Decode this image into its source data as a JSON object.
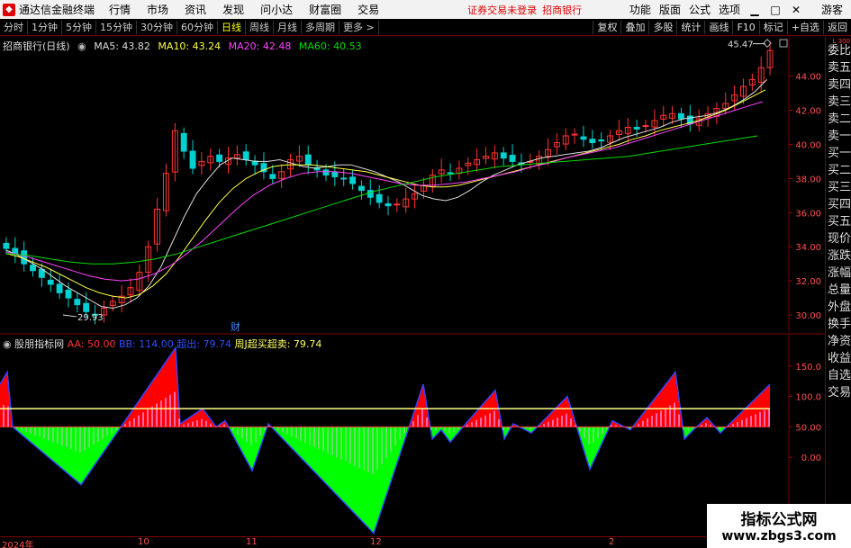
{
  "titlebar": {
    "app_title": "通达信金融终端",
    "menu": [
      "行情",
      "市场",
      "资讯",
      "发现",
      "问小达",
      "财富圈",
      "交易"
    ],
    "notice": "证券交易未登录",
    "notice2": "招商银行",
    "right_items": [
      "功能",
      "版面",
      "公式",
      "选项"
    ],
    "guest": "游客"
  },
  "toolbar": {
    "periods": [
      "分时",
      "1分钟",
      "5分钟",
      "15分钟",
      "30分钟",
      "60分钟",
      "日线",
      "周线",
      "月线",
      "多周期",
      "更多 >"
    ],
    "active_index": 6,
    "right_buttons": [
      "复权",
      "叠加",
      "多股",
      "统计",
      "画线",
      "F10",
      "标记",
      "+自选",
      "返回"
    ]
  },
  "chart_info": {
    "stock": "招商银行(日线)",
    "ma5": "MA5: 43.82",
    "ma10": "MA10: 43.24",
    "ma20": "MA20: 42.48",
    "ma60": "MA60: 40.53",
    "high_label": "45.47",
    "low_label": "29.93",
    "marker": "财"
  },
  "indicator_info": {
    "name": "股朋指标网",
    "aa": "AA: 50.00",
    "bb": "BB: 114.00",
    "cc": "超出: 79.74",
    "dd": "周J超买超卖: 79.74"
  },
  "sidebar": {
    "items": [
      "委比",
      "卖五",
      "卖四",
      "卖三",
      "卖二",
      "卖一",
      "买一",
      "买二",
      "买三",
      "买四",
      "买五",
      "现价",
      "涨跌",
      "涨幅",
      "总量",
      "外盘",
      "换手",
      "净资",
      "收益",
      "自选",
      "交易"
    ],
    "mark": "L 300"
  },
  "date_axis": [
    "2024年",
    "10",
    "11",
    "12",
    "2"
  ],
  "watermark": {
    "main": "指标公式网",
    "sub": "www.zbgs3.com"
  },
  "colors": {
    "up": "#ff3333",
    "down": "#00d0d0",
    "green_fill": "#00ff00",
    "red_fill": "#ff0000",
    "ma5": "#dddddd",
    "ma10": "#ffff44",
    "ma20": "#ff44ff",
    "ma60": "#00dd00"
  },
  "chart_data": [
    {
      "type": "candlestick",
      "title": "招商银行(日线)",
      "y_axis_ticks": [
        30.0,
        32.0,
        34.0,
        36.0,
        38.0,
        40.0,
        42.0,
        44.0
      ],
      "ylim": [
        29.0,
        46.3
      ],
      "x_labels": [
        "2024年",
        "10",
        "11",
        "12",
        "2"
      ],
      "series_close": [
        33.9,
        33.6,
        33.0,
        32.6,
        32.2,
        31.8,
        31.3,
        31.0,
        30.6,
        30.2,
        30.0,
        30.4,
        30.8,
        31.1,
        31.6,
        32.5,
        34.0,
        36.2,
        38.3,
        40.8,
        39.6,
        38.6,
        39.0,
        39.3,
        39.0,
        39.2,
        39.4,
        39.1,
        38.8,
        38.4,
        38.0,
        38.4,
        39.1,
        39.3,
        38.8,
        38.5,
        38.2,
        38.1,
        38.0,
        37.7,
        37.3,
        36.9,
        36.6,
        36.4,
        36.5,
        36.8,
        37.1,
        37.6,
        38.2,
        38.5,
        38.3,
        38.6,
        38.9,
        39.1,
        39.3,
        39.5,
        39.2,
        39.0,
        38.9,
        39.0,
        39.3,
        39.7,
        40.1,
        40.5,
        40.6,
        40.3,
        40.1,
        40.2,
        40.5,
        40.8,
        41.0,
        40.9,
        41.1,
        41.4,
        41.7,
        41.8,
        41.5,
        41.2,
        41.5,
        41.8,
        42.1,
        42.4,
        42.9,
        43.4,
        43.8,
        44.5,
        45.5
      ],
      "series": [
        {
          "name": "MA5",
          "values": [
            33.8,
            33.5,
            33.1,
            32.7,
            32.2,
            31.7,
            31.3,
            30.9,
            30.5,
            30.4,
            30.6,
            31.0,
            31.7,
            32.8,
            34.3,
            35.8,
            37.1,
            38.0,
            38.8,
            39.2,
            39.1,
            39.0,
            39.0,
            39.1,
            38.9,
            38.7,
            38.6,
            38.7,
            38.8,
            38.8,
            38.6,
            38.4,
            38.1,
            37.8,
            37.4,
            37.0,
            36.8,
            36.7,
            36.9,
            37.3,
            37.8,
            38.2,
            38.5,
            38.8,
            39.0,
            39.2,
            39.3,
            39.4,
            39.5,
            39.6,
            39.8,
            40.1,
            40.4,
            40.6,
            40.8,
            41.0,
            41.3,
            41.5,
            41.6,
            41.7,
            41.9,
            42.2,
            42.6,
            43.1,
            43.8
          ]
        },
        {
          "name": "MA10",
          "values": [
            33.6,
            33.4,
            33.1,
            32.8,
            32.4,
            32.0,
            31.6,
            31.3,
            31.1,
            31.0,
            31.2,
            31.7,
            32.4,
            33.4,
            34.5,
            35.6,
            36.6,
            37.4,
            38.0,
            38.4,
            38.7,
            38.8,
            38.8,
            38.8,
            38.7,
            38.6,
            38.5,
            38.4,
            38.2,
            38.0,
            37.8,
            37.6,
            37.5,
            37.5,
            37.6,
            37.8,
            38.0,
            38.2,
            38.4,
            38.6,
            38.8,
            39.0,
            39.2,
            39.4,
            39.6,
            39.8,
            40.0,
            40.3,
            40.5,
            40.8,
            41.0,
            41.2,
            41.4,
            41.7,
            42.0,
            42.4,
            42.8,
            43.2
          ]
        },
        {
          "name": "MA20",
          "values": [
            33.7,
            33.5,
            33.2,
            32.9,
            32.6,
            32.3,
            32.1,
            32.0,
            32.1,
            32.4,
            32.9,
            33.6,
            34.4,
            35.3,
            36.2,
            37.0,
            37.6,
            38.0,
            38.3,
            38.4,
            38.4,
            38.3,
            38.1,
            37.9,
            37.7,
            37.6,
            37.6,
            37.7,
            37.8,
            38.0,
            38.2,
            38.4,
            38.7,
            38.9,
            39.2,
            39.4,
            39.6,
            39.8,
            40.1,
            40.4,
            40.7,
            41.0,
            41.3,
            41.6,
            41.9,
            42.2,
            42.5
          ]
        },
        {
          "name": "MA60",
          "values": [
            33.6,
            33.5,
            33.3,
            33.1,
            33.0,
            33.0,
            33.1,
            33.3,
            33.6,
            34.0,
            34.4,
            34.8,
            35.2,
            35.6,
            36.0,
            36.4,
            36.8,
            37.2,
            37.5,
            37.8,
            38.1,
            38.3,
            38.5,
            38.7,
            38.8,
            38.9,
            39.0,
            39.1,
            39.2,
            39.3,
            39.5,
            39.7,
            39.9,
            40.1,
            40.3,
            40.5
          ]
        }
      ]
    },
    {
      "type": "area",
      "title": "股朋指标网",
      "y_axis_ticks": [
        0.0,
        50.0,
        100.0,
        150.0
      ],
      "ylim": [
        -130,
        200
      ],
      "reference_lines": [
        50,
        80
      ],
      "x": [
        0,
        8,
        14,
        90,
        195,
        200,
        225,
        240,
        250,
        280,
        298,
        415,
        470,
        480,
        490,
        500,
        520,
        550,
        560,
        570,
        590,
        600,
        630,
        655,
        680,
        700,
        750,
        760,
        770,
        785,
        800,
        855
      ],
      "values": [
        120,
        140,
        50,
        -45,
        180,
        55,
        80,
        50,
        60,
        -22,
        55,
        -125,
        120,
        30,
        45,
        25,
        60,
        110,
        30,
        55,
        40,
        55,
        100,
        -20,
        60,
        45,
        140,
        30,
        45,
        65,
        40,
        120
      ]
    }
  ]
}
